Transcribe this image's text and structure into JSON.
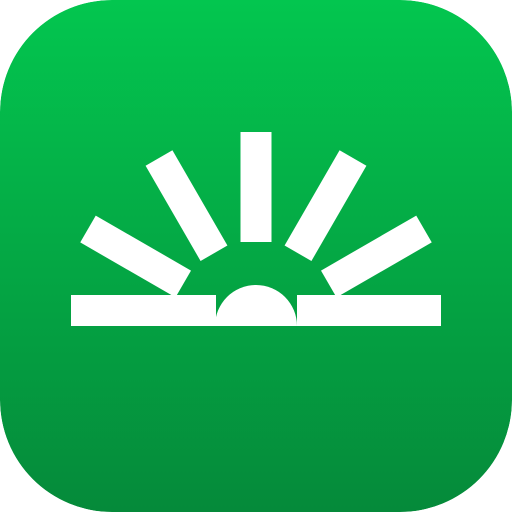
{
  "icon": {
    "name": "sunrise-logo",
    "gradient_top": "#03C64F",
    "gradient_bottom": "#058A3A",
    "symbol_color": "#FFFFFF"
  }
}
